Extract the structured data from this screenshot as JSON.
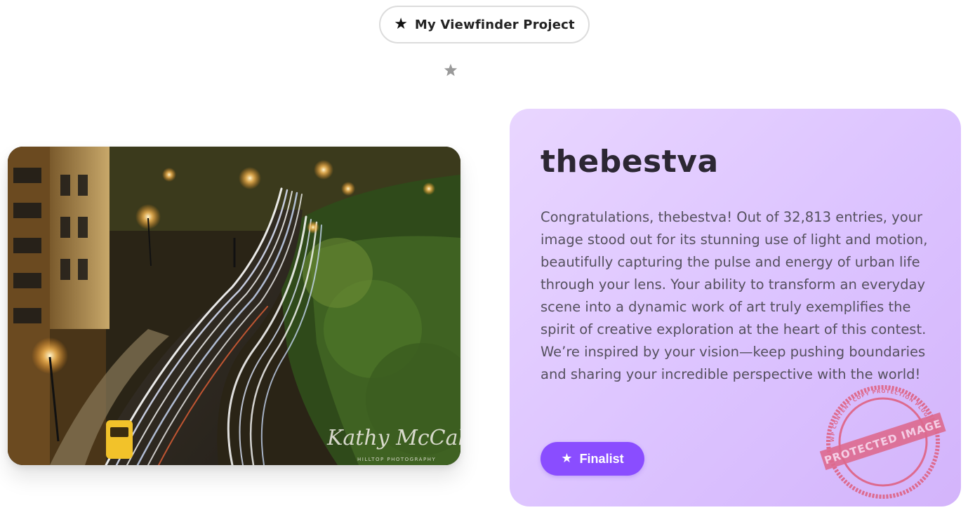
{
  "header": {
    "project_label": "My Viewfinder Project",
    "project_icon": "star-icon",
    "divider_icon": "star-icon"
  },
  "photo": {
    "subject": "long-exposure night street with light trails",
    "signature": "Kathy McCabe",
    "signature_subtitle": "HILLTOP PHOTOGRAPHY"
  },
  "winner": {
    "name": "thebestva",
    "message": "Congratulations, thebestva! Out of 32,813 entries, your image stood out for its stunning use of light and motion, beautifully capturing the pulse and energy of urban life through your lens. Your ability to transform an everyday scene into a dynamic work of art truly exemplifies the spirit of creative exploration at the heart of this contest. We’re inspired by your vision—keep pushing boundaries and sharing your incredible perspective with the world!",
    "badge_label": "Finalist",
    "badge_icon": "star-icon"
  },
  "stamp": {
    "main_text": "PROTECTED IMAGE",
    "ring_text": "WP CONTENT COPY PROTECTION PLUGIN"
  },
  "colors": {
    "panel_start": "#e9d6ff",
    "panel_end": "#d3b4fb",
    "badge": "#8a4dff",
    "stamp": "#e0506a"
  }
}
